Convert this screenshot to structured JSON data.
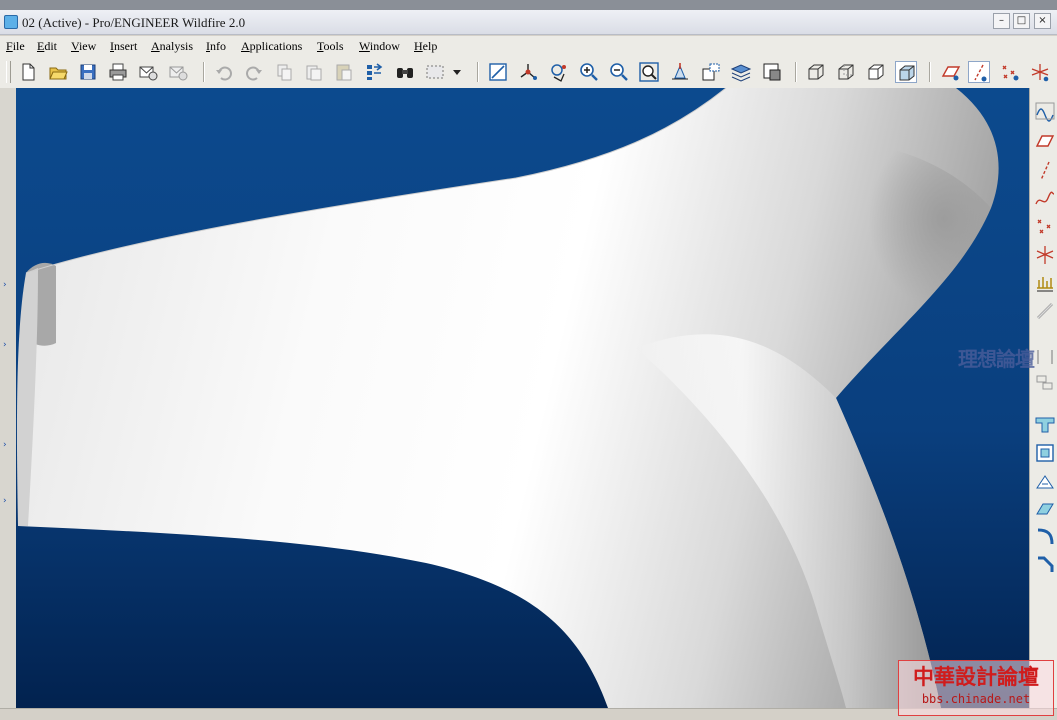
{
  "window": {
    "title": "02 (Active) - Pro/ENGINEER Wildfire 2.0",
    "controls": [
      {
        "name": "minimize",
        "glyph": "–"
      },
      {
        "name": "maximize",
        "glyph": "□"
      },
      {
        "name": "close",
        "glyph": "×"
      }
    ]
  },
  "menubar": {
    "items": [
      {
        "key": "F",
        "rest": "ile"
      },
      {
        "key": "E",
        "rest": "dit"
      },
      {
        "key": "V",
        "rest": "iew"
      },
      {
        "key": "I",
        "rest": "nsert"
      },
      {
        "key": "A",
        "rest": "nalysis"
      },
      {
        "key": "I",
        "rest": "nfo"
      },
      {
        "key": "A",
        "rest": "pplications"
      },
      {
        "key": "T",
        "rest": "ools"
      },
      {
        "key": "W",
        "rest": "indow"
      },
      {
        "key": "H",
        "rest": "elp"
      }
    ]
  },
  "toolbar": {
    "buttons": [
      "new-icon",
      "open-icon",
      "save-icon",
      "print-icon",
      "email-icon",
      "email-link-icon",
      "undo-icon",
      "redo-icon",
      "cut-icon",
      "copy-icon",
      "paste-icon",
      "regenerate-icon",
      "find-icon",
      "select-box-icon",
      "dropdown-arrow-icon",
      "repaint-icon",
      "spin-center-icon",
      "orient-mode-icon",
      "zoom-in-icon",
      "zoom-out-icon",
      "refit-icon",
      "reorient-icon",
      "saved-views-icon",
      "layers-icon",
      "model-display-icon",
      "wireframe-icon",
      "hidden-line-icon",
      "no-hidden-icon",
      "shading-icon",
      "datum-planes-icon",
      "datum-axes-icon",
      "datum-points-icon",
      "coordinate-systems-icon"
    ],
    "active": [
      "shading-icon",
      "datum-axes-icon"
    ]
  },
  "rightbar": {
    "buttons": [
      "sketch-tool-icon",
      "datum-plane-tool-icon",
      "datum-axis-tool-icon",
      "datum-curve-tool-icon",
      "datum-point-tool-icon",
      "coordinate-system-tool-icon",
      "analysis-tool-icon",
      "sketched-datum-curve-icon",
      "styles-tool-icon",
      "offset-tool-icon",
      "hole-tool-icon",
      "shell-tool-icon",
      "rib-tool-icon",
      "draft-tool-icon",
      "round-tool-icon",
      "chamfer-tool-icon"
    ]
  },
  "viewport": {
    "background_top": "#0c4a8e",
    "background_bottom": "#02224f",
    "model_light": "#ffffff",
    "model_shadow": "#8c8c8c"
  },
  "watermarks": {
    "logo_text": "理想論壇",
    "forum_name": "中華設計論壇",
    "forum_url": "bbs.chinade.net"
  },
  "colors": {
    "chrome": "#ecebe6",
    "icon_blue": "#1f5fa8",
    "icon_red": "#c23a2a",
    "watermark_red": "#d01c1c"
  }
}
